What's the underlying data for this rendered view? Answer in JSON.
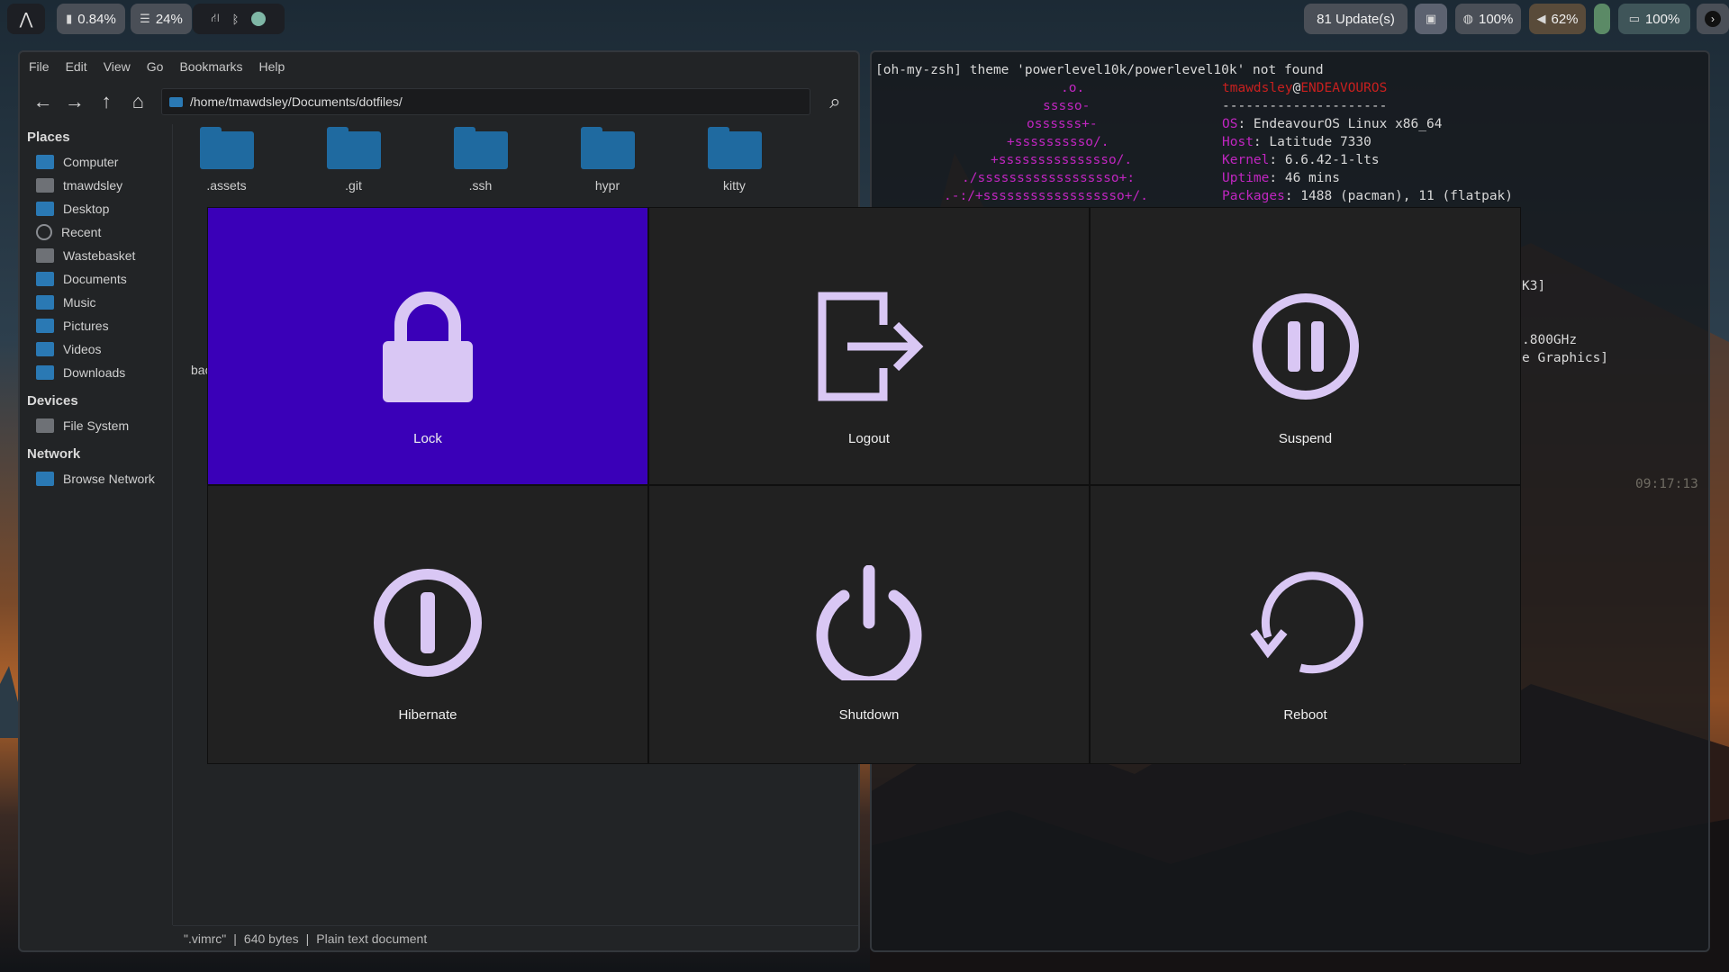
{
  "topbar": {
    "cpu": "0.84%",
    "memory": "24%",
    "updates": "81 Update(s)",
    "brightness": "100%",
    "volume": "62%",
    "battery": "100%"
  },
  "file_manager": {
    "menu": [
      "File",
      "Edit",
      "View",
      "Go",
      "Bookmarks",
      "Help"
    ],
    "path": "/home/tmawdsley/Documents/dotfiles/",
    "sections": {
      "places": "Places",
      "devices": "Devices",
      "network": "Network"
    },
    "places": [
      "Computer",
      "tmawdsley",
      "Desktop",
      "Recent",
      "Wastebasket",
      "Documents",
      "Music",
      "Pictures",
      "Videos",
      "Downloads"
    ],
    "devices": [
      "File System"
    ],
    "network": [
      "Browse Network"
    ],
    "files": [
      ".assets",
      ".git",
      ".ssh",
      "hypr",
      "kitty"
    ],
    "partial_file": "bac",
    "status": {
      "name": "\".vimrc\"",
      "sep1": "|",
      "size": "640 bytes",
      "sep2": "|",
      "type": "Plain text document"
    }
  },
  "terminal": {
    "theme_line": "[oh-my-zsh] theme 'powerlevel10k/powerlevel10k' not found",
    "user": "tmawdsley",
    "at": "@",
    "host_name": "ENDEAVOUROS",
    "rule": "---------------------",
    "logo": [
      ".o.",
      "sssso-",
      "ossssss+-",
      "+ssssssssso/.",
      "+sssssssssssssso/.",
      "./ssssssssssssssssso+:",
      ".-:/+ssssssssssssssssso+/."
    ],
    "info": [
      {
        "key": "OS",
        "value": ": EndeavourOS Linux x86_64"
      },
      {
        "key": "Host",
        "value": ": Latitude 7330"
      },
      {
        "key": "Kernel",
        "value": ": 6.6.42-1-lts"
      },
      {
        "key": "Uptime",
        "value": ": 46 mins"
      },
      {
        "key": "Packages",
        "value": ": 1488 (pacman), 11 (flatpak)"
      }
    ],
    "fragments": [
      "K3]",
      ".800GHz",
      "e Graphics]"
    ],
    "clock": "09:17:13"
  },
  "power_menu": {
    "options": [
      {
        "label": "Lock",
        "icon": "lock-icon",
        "selected": true
      },
      {
        "label": "Logout",
        "icon": "logout-icon",
        "selected": false
      },
      {
        "label": "Suspend",
        "icon": "pause-icon",
        "selected": false
      },
      {
        "label": "Hibernate",
        "icon": "hibernate-icon",
        "selected": false
      },
      {
        "label": "Shutdown",
        "icon": "power-icon",
        "selected": false
      },
      {
        "label": "Reboot",
        "icon": "reboot-icon",
        "selected": false
      }
    ],
    "colors": {
      "selected": "#3a00b8",
      "icon": "#d9c7f4",
      "background": "#212121"
    }
  }
}
